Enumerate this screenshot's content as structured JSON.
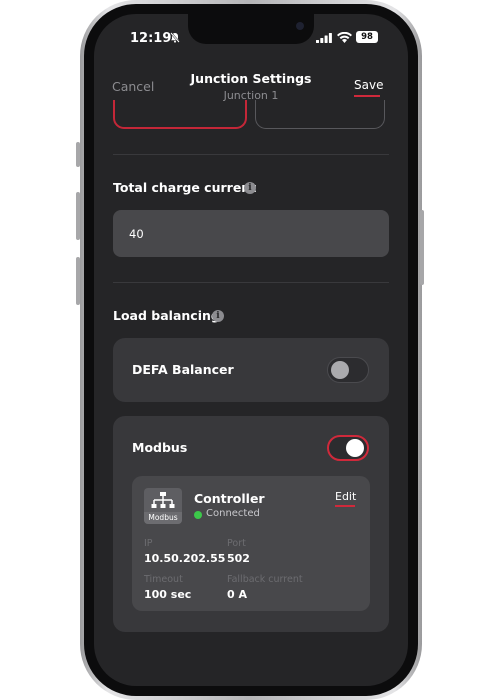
{
  "status_bar": {
    "time": "12:19",
    "battery": "98"
  },
  "header": {
    "cancel_label": "Cancel",
    "title": "Junction Settings",
    "subtitle": "Junction 1",
    "save_label": "Save"
  },
  "charge": {
    "label": "Total charge current",
    "value": "40"
  },
  "load_balancing": {
    "label": "Load balancing",
    "defa": {
      "label": "DEFA Balancer",
      "enabled": false
    },
    "modbus": {
      "label": "Modbus",
      "enabled": true,
      "controller": {
        "icon_label": "Modbus",
        "name": "Controller",
        "status": "Connected",
        "edit_label": "Edit",
        "ip_label": "IP",
        "ip_value": "10.50.202.55",
        "port_label": "Port",
        "port_value": "502",
        "timeout_label": "Timeout",
        "timeout_value": "100 sec",
        "fallback_label": "Fallback current",
        "fallback_value": "0 A"
      }
    }
  },
  "colors": {
    "accent": "#d0293b",
    "connected": "#3cc84a",
    "background": "#252527",
    "card": "#38383b"
  },
  "icons": [
    "mute-icon",
    "signal-icon",
    "wifi-icon",
    "info-icon",
    "modbus-network-icon"
  ]
}
